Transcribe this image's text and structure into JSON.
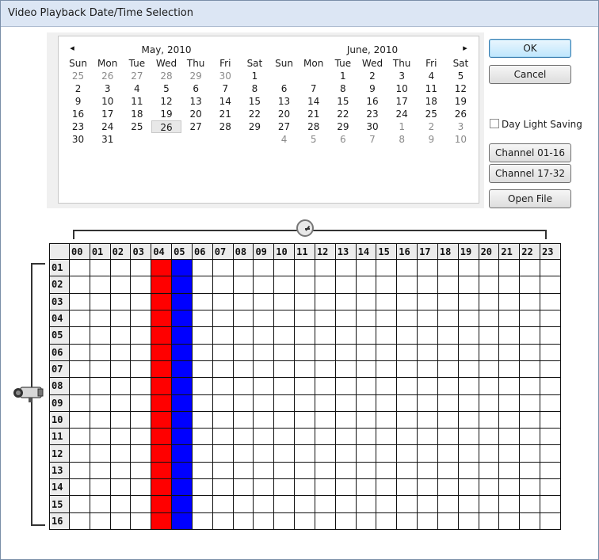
{
  "window": {
    "title": "Video Playback Date/Time Selection"
  },
  "calendar": {
    "day_headers": [
      "Sun",
      "Mon",
      "Tue",
      "Wed",
      "Thu",
      "Fri",
      "Sat"
    ],
    "months": [
      {
        "title": "May, 2010",
        "days": [
          {
            "d": "25",
            "o": true
          },
          {
            "d": "26",
            "o": true
          },
          {
            "d": "27",
            "o": true
          },
          {
            "d": "28",
            "o": true
          },
          {
            "d": "29",
            "o": true
          },
          {
            "d": "30",
            "o": true
          },
          {
            "d": "1"
          },
          {
            "d": "2"
          },
          {
            "d": "3"
          },
          {
            "d": "4"
          },
          {
            "d": "5"
          },
          {
            "d": "6"
          },
          {
            "d": "7"
          },
          {
            "d": "8"
          },
          {
            "d": "9"
          },
          {
            "d": "10"
          },
          {
            "d": "11"
          },
          {
            "d": "12"
          },
          {
            "d": "13"
          },
          {
            "d": "14"
          },
          {
            "d": "15"
          },
          {
            "d": "16"
          },
          {
            "d": "17"
          },
          {
            "d": "18"
          },
          {
            "d": "19"
          },
          {
            "d": "20"
          },
          {
            "d": "21"
          },
          {
            "d": "22"
          },
          {
            "d": "23"
          },
          {
            "d": "24"
          },
          {
            "d": "25"
          },
          {
            "d": "26",
            "sel": true
          },
          {
            "d": "27"
          },
          {
            "d": "28"
          },
          {
            "d": "29"
          },
          {
            "d": "30"
          },
          {
            "d": "31"
          },
          {
            "d": ""
          },
          {
            "d": ""
          },
          {
            "d": ""
          },
          {
            "d": ""
          },
          {
            "d": ""
          }
        ]
      },
      {
        "title": "June, 2010",
        "days": [
          {
            "d": ""
          },
          {
            "d": ""
          },
          {
            "d": "1"
          },
          {
            "d": "2"
          },
          {
            "d": "3"
          },
          {
            "d": "4"
          },
          {
            "d": "5"
          },
          {
            "d": "6"
          },
          {
            "d": "7"
          },
          {
            "d": "8"
          },
          {
            "d": "9"
          },
          {
            "d": "10"
          },
          {
            "d": "11"
          },
          {
            "d": "12"
          },
          {
            "d": "13"
          },
          {
            "d": "14"
          },
          {
            "d": "15"
          },
          {
            "d": "16"
          },
          {
            "d": "17"
          },
          {
            "d": "18"
          },
          {
            "d": "19"
          },
          {
            "d": "20"
          },
          {
            "d": "21"
          },
          {
            "d": "22"
          },
          {
            "d": "23"
          },
          {
            "d": "24"
          },
          {
            "d": "25"
          },
          {
            "d": "26"
          },
          {
            "d": "27"
          },
          {
            "d": "28"
          },
          {
            "d": "29"
          },
          {
            "d": "30"
          },
          {
            "d": "1",
            "o": true
          },
          {
            "d": "2",
            "o": true
          },
          {
            "d": "3",
            "o": true
          },
          {
            "d": "4",
            "o": true
          },
          {
            "d": "5",
            "o": true
          },
          {
            "d": "6",
            "o": true
          },
          {
            "d": "7",
            "o": true
          },
          {
            "d": "8",
            "o": true
          },
          {
            "d": "9",
            "o": true
          },
          {
            "d": "10",
            "o": true
          }
        ]
      }
    ],
    "prev_icon": "chevron-left-icon",
    "next_icon": "chevron-right-icon",
    "prev_glyph": "◂",
    "next_glyph": "▸"
  },
  "buttons": {
    "ok": "OK",
    "cancel": "Cancel",
    "channel_1": "Channel 01-16",
    "channel_2": "Channel 17-32",
    "open_file": "Open File"
  },
  "daylight_saving": {
    "label": "Day Light Saving",
    "checked": false
  },
  "timeline": {
    "hours": [
      "00",
      "01",
      "02",
      "03",
      "04",
      "05",
      "06",
      "07",
      "08",
      "09",
      "10",
      "11",
      "12",
      "13",
      "14",
      "15",
      "16",
      "17",
      "18",
      "19",
      "20",
      "21",
      "22",
      "23"
    ],
    "channels": [
      "01",
      "02",
      "03",
      "04",
      "05",
      "06",
      "07",
      "08",
      "09",
      "10",
      "11",
      "12",
      "13",
      "14",
      "15",
      "16"
    ],
    "recorded": [
      {
        "hour": "04",
        "color": "#ff0000",
        "channels": "01-16"
      },
      {
        "hour": "05",
        "color": "#0000ff",
        "channels": "01-16"
      }
    ],
    "clock_icon": "clock-icon",
    "camera_icon": "camera-icon"
  }
}
